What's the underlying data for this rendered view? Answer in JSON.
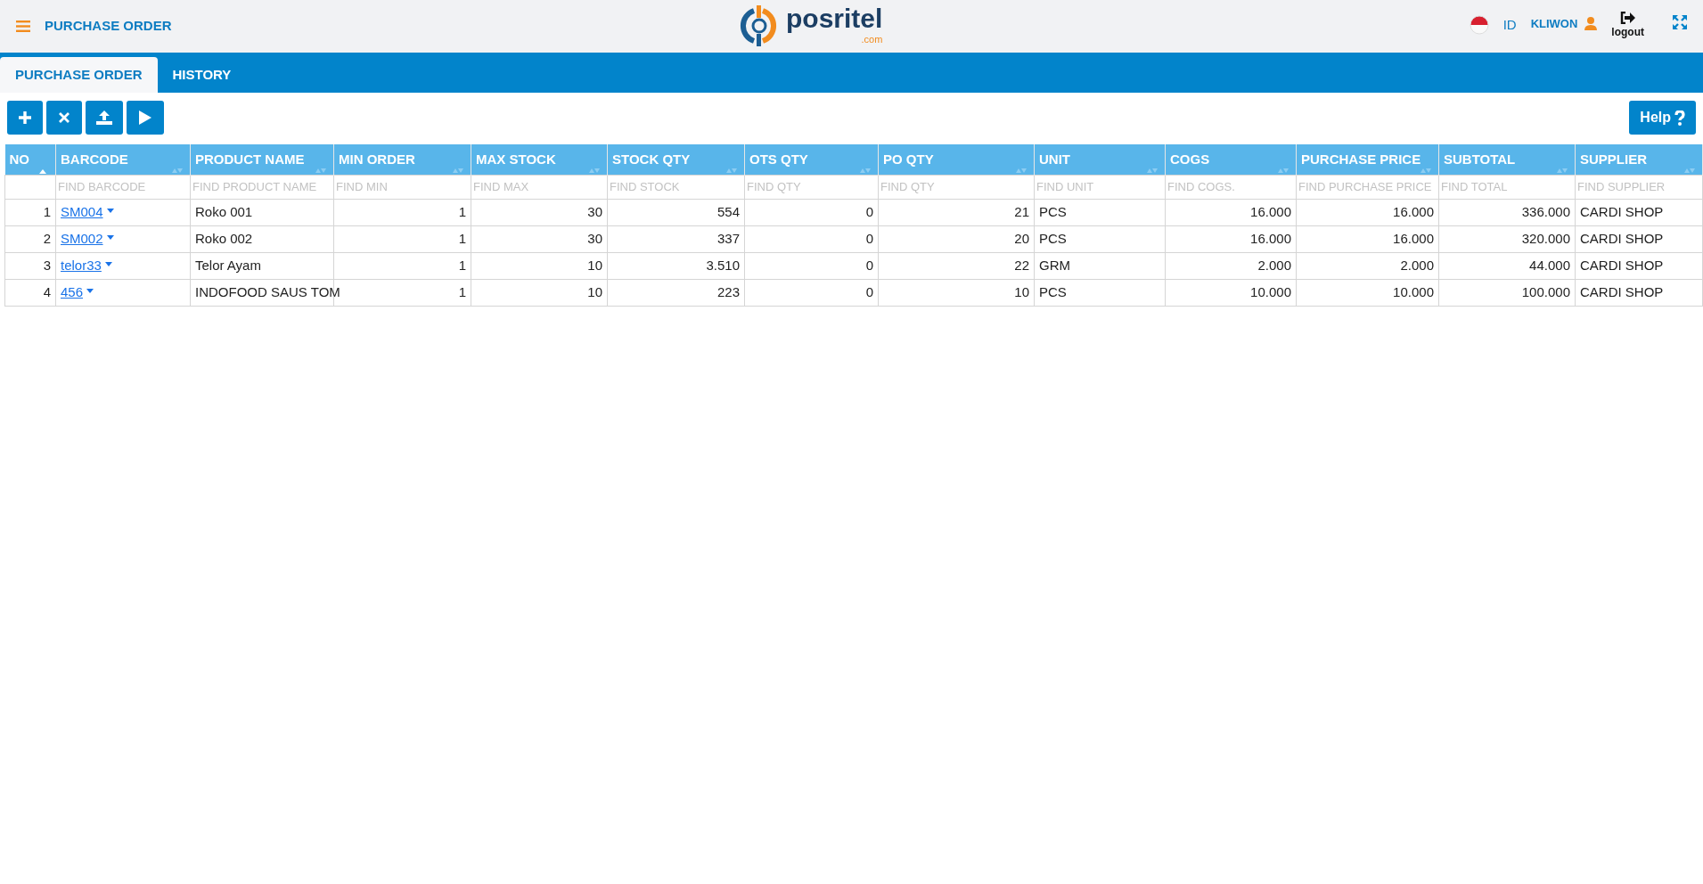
{
  "header": {
    "title": "PURCHASE ORDER",
    "logo_text": "posritel",
    "logo_suffix": ".com",
    "language": "ID",
    "user": "KLIWON",
    "logout": "logout"
  },
  "tabs": [
    {
      "label": "PURCHASE ORDER",
      "selected": true
    },
    {
      "label": "HISTORY",
      "selected": false
    }
  ],
  "help_button": "Help",
  "table": {
    "columns": [
      {
        "label": "NO",
        "kind": "number",
        "sorted": true
      },
      {
        "label": "BARCODE",
        "placeholder": "FIND BARCODE",
        "kind": "link",
        "sorted": false
      },
      {
        "label": "PRODUCT NAME",
        "placeholder": "FIND PRODUCT NAME",
        "kind": "text",
        "sorted": false
      },
      {
        "label": "MIN ORDER",
        "placeholder": "FIND MIN",
        "kind": "number",
        "sorted": false
      },
      {
        "label": "MAX STOCK",
        "placeholder": "FIND MAX",
        "kind": "number",
        "sorted": false
      },
      {
        "label": "STOCK QTY",
        "placeholder": "FIND STOCK",
        "kind": "number",
        "sorted": false
      },
      {
        "label": "OTS QTY",
        "placeholder": "FIND QTY",
        "kind": "number",
        "sorted": false
      },
      {
        "label": "PO QTY",
        "placeholder": "FIND QTY",
        "kind": "number",
        "sorted": false
      },
      {
        "label": "UNIT",
        "placeholder": "FIND UNIT",
        "kind": "text",
        "sorted": false
      },
      {
        "label": "COGS",
        "placeholder": "FIND COGS.",
        "kind": "number",
        "sorted": false
      },
      {
        "label": "PURCHASE PRICE",
        "placeholder": "FIND PURCHASE PRICE",
        "kind": "number",
        "sorted": false
      },
      {
        "label": "SUBTOTAL",
        "placeholder": "FIND TOTAL",
        "kind": "number",
        "sorted": false
      },
      {
        "label": "SUPPLIER",
        "placeholder": "FIND SUPPLIER",
        "kind": "text",
        "sorted": false
      }
    ],
    "rows": [
      [
        "1",
        "SM004",
        "Roko 001",
        "1",
        "30",
        "554",
        "0",
        "21",
        "PCS",
        "16.000",
        "16.000",
        "336.000",
        "CARDI SHOP"
      ],
      [
        "2",
        "SM002",
        "Roko 002",
        "1",
        "30",
        "337",
        "0",
        "20",
        "PCS",
        "16.000",
        "16.000",
        "320.000",
        "CARDI SHOP"
      ],
      [
        "3",
        "telor33",
        "Telor Ayam",
        "1",
        "10",
        "3.510",
        "0",
        "22",
        "GRM",
        "2.000",
        "2.000",
        "44.000",
        "CARDI SHOP"
      ],
      [
        "4",
        "456",
        "INDOFOOD SAUS TOM",
        "1",
        "10",
        "223",
        "0",
        "10",
        "PCS",
        "10.000",
        "10.000",
        "100.000",
        "CARDI SHOP"
      ]
    ]
  }
}
